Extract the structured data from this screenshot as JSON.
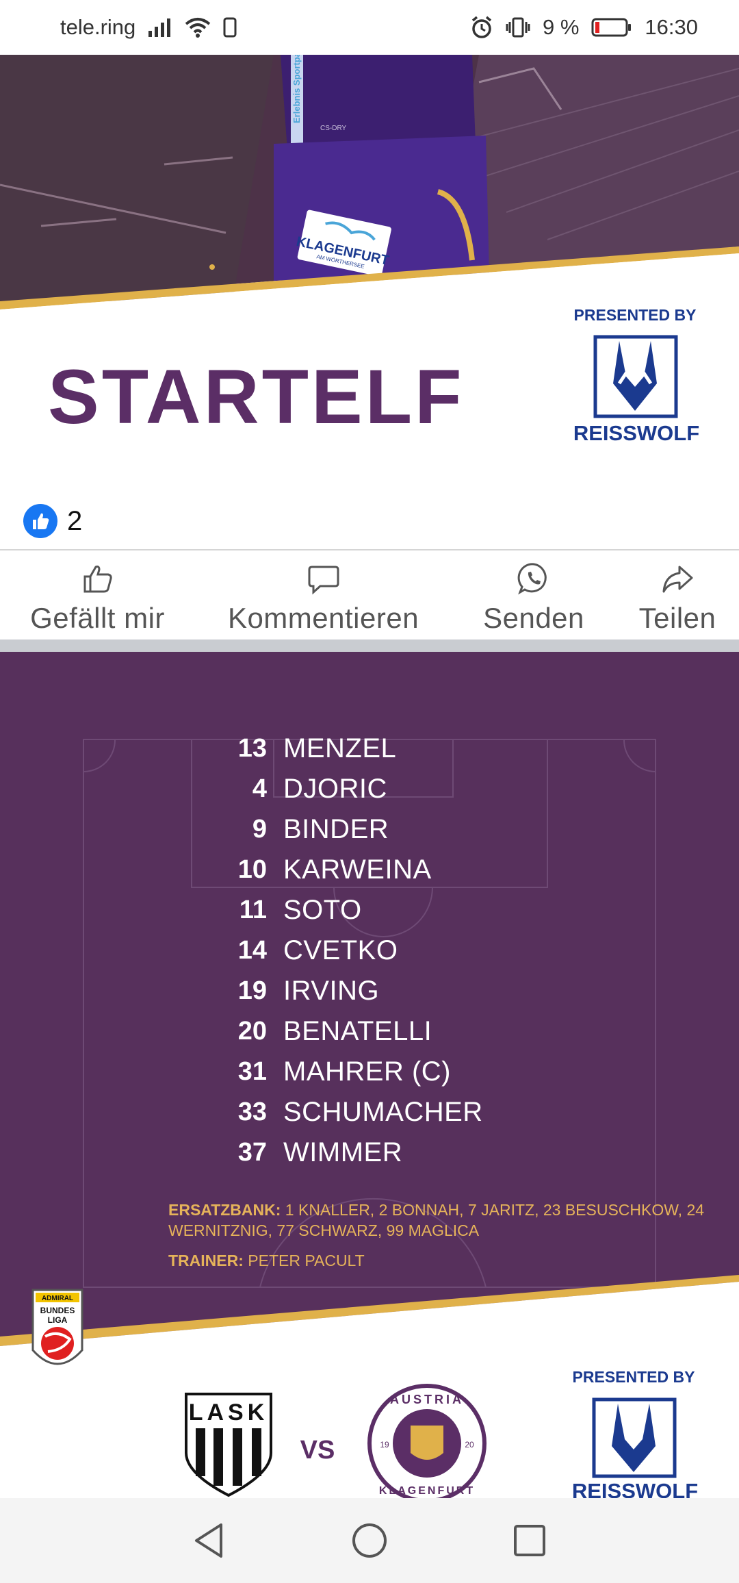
{
  "status_bar": {
    "carrier": "tele.ring",
    "battery_percent": "9 %",
    "time": "16:30",
    "icons": [
      "signal-icon",
      "wifi-icon",
      "sim-icon",
      "alarm-icon",
      "vibrate-icon",
      "battery-icon"
    ]
  },
  "post1": {
    "sponsor_shorts_text": "KLAGENFURT",
    "sponsor_shorts_sub": "AM WÖRTHERSEE",
    "sleeve_text": "Erlebnis Sportpark",
    "heading": "STARTELF",
    "presented_by": "PRESENTED BY",
    "sponsor_name": "REISSWOLF",
    "colors": {
      "purple": "#5b2e66",
      "gold": "#e0b14a",
      "navy": "#1b3a8f"
    }
  },
  "reactions": {
    "count": "2",
    "icon": "like-icon"
  },
  "actions": [
    {
      "label": "Gefällt mir",
      "icon": "thumbs-up-icon"
    },
    {
      "label": "Kommentieren",
      "icon": "comment-icon"
    },
    {
      "label": "Senden",
      "icon": "whatsapp-icon"
    },
    {
      "label": "Teilen",
      "icon": "share-icon"
    }
  ],
  "post2": {
    "lineup": [
      {
        "number": "13",
        "name": "MENZEL"
      },
      {
        "number": "4",
        "name": "DJORIC"
      },
      {
        "number": "9",
        "name": "BINDER"
      },
      {
        "number": "10",
        "name": "KARWEINA"
      },
      {
        "number": "11",
        "name": "SOTO"
      },
      {
        "number": "14",
        "name": "CVETKO"
      },
      {
        "number": "19",
        "name": "IRVING"
      },
      {
        "number": "20",
        "name": "BENATELLI"
      },
      {
        "number": "31",
        "name": "MAHRER (C)"
      },
      {
        "number": "33",
        "name": "SCHUMACHER"
      },
      {
        "number": "37",
        "name": "WIMMER"
      }
    ],
    "subs_label": "ERSATZBANK:",
    "subs_text": "1 KNALLER, 2 BONNAH, 7 JARITZ, 23 BESUSCHKOW, 24 WERNITZNIG, 77 SCHWARZ, 99 MAGLICA",
    "coach_label": "TRAINER:",
    "coach_name": "PETER PACULT",
    "league_logo": {
      "top": "ADMIRAL",
      "line1": "BUNDES",
      "line2": "LIGA"
    },
    "home_team": "LASK",
    "vs": "VS",
    "away_team_top": "AUSTRIA",
    "away_team_bottom": "KLAGENFURT",
    "away_team_year_left": "19",
    "away_team_year_right": "20",
    "presented_by": "PRESENTED BY",
    "sponsor_name": "REISSWOLF"
  },
  "nav_bar": {
    "back": "back-icon",
    "home": "home-icon",
    "recents": "recents-icon"
  }
}
